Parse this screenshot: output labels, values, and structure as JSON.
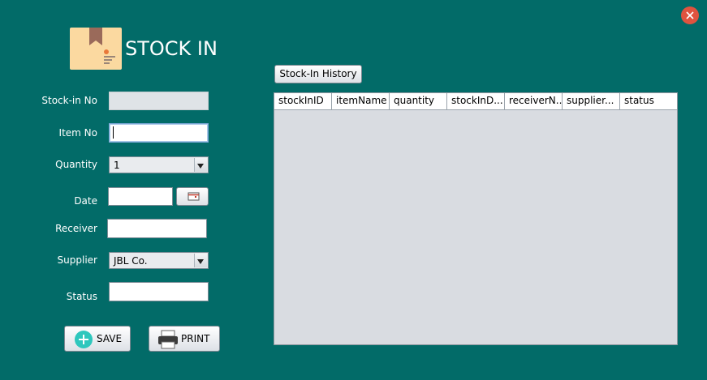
{
  "window": {
    "title": "STOCK IN"
  },
  "form": {
    "stock_in_no": {
      "label": "Stock-in No",
      "value": ""
    },
    "item_no": {
      "label": "Item No",
      "value": ""
    },
    "quantity": {
      "label": "Quantity",
      "value": "1"
    },
    "date": {
      "label": "Date",
      "value": ""
    },
    "receiver": {
      "label": "Receiver",
      "value": ""
    },
    "supplier": {
      "label": "Supplier",
      "value": "JBL Co."
    },
    "status": {
      "label": "Status",
      "value": ""
    }
  },
  "actions": {
    "save_label": "SAVE",
    "print_label": "PRINT"
  },
  "history": {
    "button_label": "Stock-In History",
    "columns": [
      "stockInID",
      "itemName",
      "quantity",
      "stockInD...",
      "receiverN...",
      "supplier...",
      "status"
    ]
  },
  "colors": {
    "background": "#026b68",
    "close": "#e0533f",
    "save_icon": "#2ec7bd"
  },
  "icons": {
    "logo": "package-icon",
    "close": "close-icon",
    "save": "plus-circle-icon",
    "print": "printer-icon",
    "calendar": "calendar-icon"
  }
}
